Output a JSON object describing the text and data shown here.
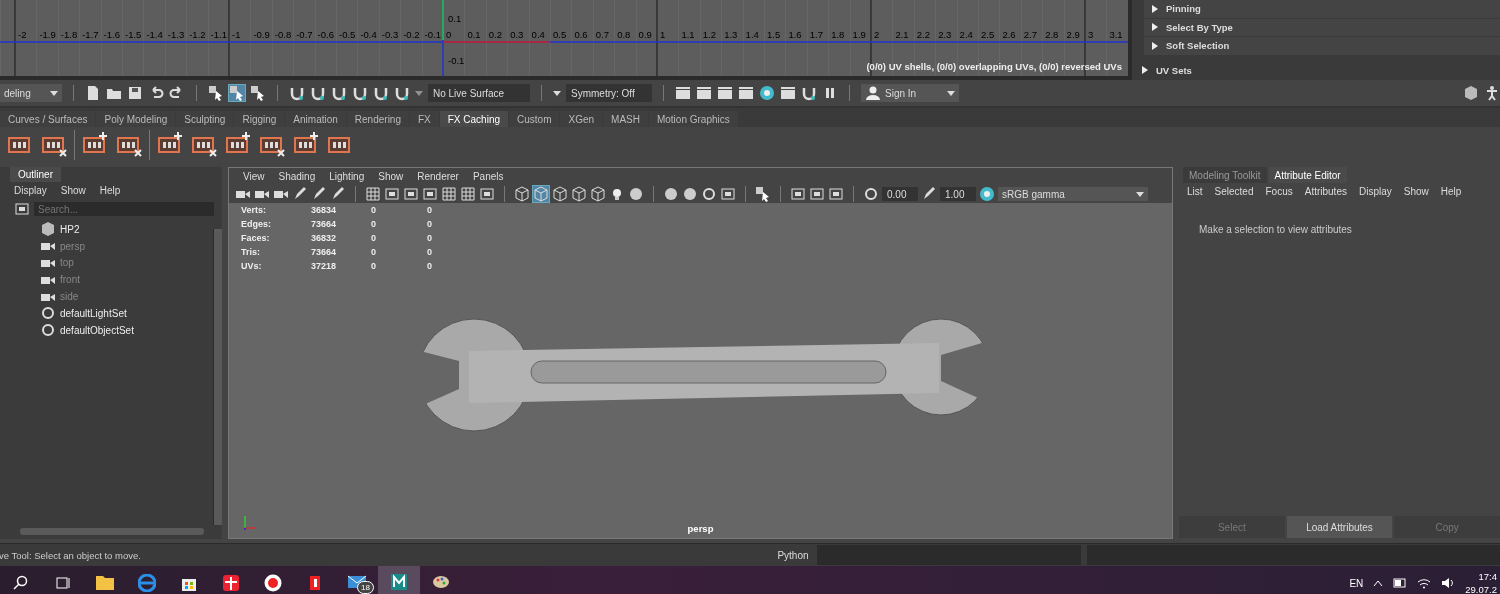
{
  "uv_editor": {
    "u_labels": [
      "-2",
      "-1.9",
      "-1.8",
      "-1.7",
      "-1.6",
      "-1.5",
      "-1.4",
      "-1.3",
      "-1.2",
      "-1.1",
      "-1",
      "-0.9",
      "-0.8",
      "-0.7",
      "-0.6",
      "-0.5",
      "-0.4",
      "-0.3",
      "-0.2",
      "-0.1",
      "0",
      "0.1",
      "0.2",
      "0.3",
      "0.4",
      "0.5",
      "0.6",
      "0.7",
      "0.8",
      "0.9",
      "1",
      "1.1",
      "1.2",
      "1.3",
      "1.4",
      "1.5",
      "1.6",
      "1.7",
      "1.8",
      "1.9",
      "2",
      "2.1",
      "2.2",
      "2.3",
      "2.4",
      "2.5",
      "2.6",
      "2.7",
      "2.8",
      "2.9",
      "3",
      "3.1"
    ],
    "v_labels": [
      "0.1",
      "-0.1"
    ],
    "status": "(0/0) UV shells, (0/0) overlapping UVs, (0/0) reversed UVs"
  },
  "uv_toolkit": {
    "sections": [
      {
        "label": "Pinning",
        "expanded": false
      },
      {
        "label": "Select By Type",
        "expanded": false
      },
      {
        "label": "Soft Selection",
        "expanded": false
      }
    ],
    "uv_sets": {
      "label": "UV Sets",
      "expanded": false
    }
  },
  "status_line": {
    "menu_set": "deling",
    "selection_modes": [
      {
        "selected": false
      },
      {
        "selected": true
      },
      {
        "selected": false
      }
    ],
    "live_surface": "No Live Surface",
    "symmetry": "Symmetry: Off",
    "sign_in": "Sign In"
  },
  "shelf_tabs": [
    {
      "label": "Curves / Surfaces",
      "selected": false
    },
    {
      "label": "Poly Modeling",
      "selected": false
    },
    {
      "label": "Sculpting",
      "selected": false
    },
    {
      "label": "Rigging",
      "selected": false
    },
    {
      "label": "Animation",
      "selected": false
    },
    {
      "label": "Rendering",
      "selected": false
    },
    {
      "label": "FX",
      "selected": false
    },
    {
      "label": "FX Caching",
      "selected": true
    },
    {
      "label": "Custom",
      "selected": false
    },
    {
      "label": "XGen",
      "selected": false
    },
    {
      "label": "MASH",
      "selected": false
    },
    {
      "label": "Motion Graphics",
      "selected": false
    }
  ],
  "outliner": {
    "title": "Outliner",
    "menu": [
      "Display",
      "Show",
      "Help"
    ],
    "search": {
      "placeholder": "Search..."
    },
    "items": [
      {
        "label": "HP2",
        "kind": "mesh",
        "dimmed": false
      },
      {
        "label": "persp",
        "kind": "camera",
        "dimmed": true
      },
      {
        "label": "top",
        "kind": "camera",
        "dimmed": true
      },
      {
        "label": "front",
        "kind": "camera",
        "dimmed": true
      },
      {
        "label": "side",
        "kind": "camera",
        "dimmed": true
      },
      {
        "label": "defaultLightSet",
        "kind": "set",
        "dimmed": false
      },
      {
        "label": "defaultObjectSet",
        "kind": "set",
        "dimmed": false
      }
    ]
  },
  "viewport": {
    "menu": [
      "View",
      "Shading",
      "Lighting",
      "Show",
      "Renderer",
      "Panels"
    ],
    "shading_modes": [
      {
        "selected": false
      },
      {
        "selected": true
      },
      {
        "selected": false
      },
      {
        "selected": false
      },
      {
        "selected": false
      }
    ],
    "exposure": "0.00",
    "gamma": "1.00",
    "color_space": "sRGB gamma",
    "stats": [
      {
        "label": "Verts:",
        "values": [
          "36834",
          "0",
          "0"
        ]
      },
      {
        "label": "Edges:",
        "values": [
          "73664",
          "0",
          "0"
        ]
      },
      {
        "label": "Faces:",
        "values": [
          "36832",
          "0",
          "0"
        ]
      },
      {
        "label": "Tris:",
        "values": [
          "73664",
          "0",
          "0"
        ]
      },
      {
        "label": "UVs:",
        "values": [
          "37218",
          "0",
          "0"
        ]
      }
    ],
    "camera": "persp"
  },
  "attribute_editor": {
    "tabs": [
      {
        "label": "Modeling Toolkit",
        "selected": false
      },
      {
        "label": "Attribute Editor",
        "selected": true
      }
    ],
    "menu": [
      "List",
      "Selected",
      "Focus",
      "Attributes",
      "Display",
      "Show",
      "Help"
    ],
    "message": "Make a selection to view attributes",
    "buttons": [
      {
        "label": "Select",
        "disabled": true
      },
      {
        "label": "Load Attributes",
        "disabled": false
      },
      {
        "label": "Copy",
        "disabled": true
      }
    ]
  },
  "help_line": "ve Tool: Select an object to move.",
  "command_line": {
    "language": "Python"
  },
  "taskbar": {
    "mail_badge": "18",
    "language": "EN",
    "time": "17:4",
    "date": "29.07.2"
  }
}
